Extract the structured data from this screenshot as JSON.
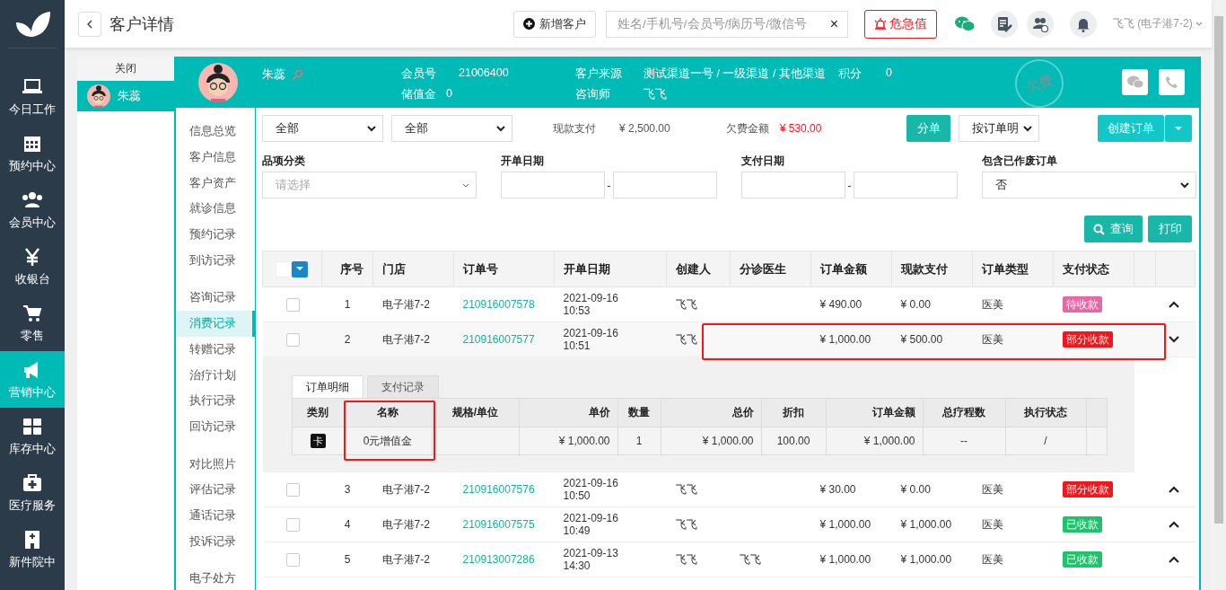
{
  "nav": {
    "items": [
      {
        "label": "今日工作",
        "selected": false
      },
      {
        "label": "预约中心",
        "selected": false
      },
      {
        "label": "会员中心",
        "selected": false
      },
      {
        "label": "收银台",
        "selected": false
      },
      {
        "label": "零售",
        "selected": false
      },
      {
        "label": "营销中心",
        "selected": true
      },
      {
        "label": "库存中心",
        "selected": false
      },
      {
        "label": "医疗服务",
        "selected": false
      },
      {
        "label": "新件院中",
        "selected": false
      }
    ]
  },
  "header": {
    "title": "客户详情",
    "add_button": "新增客户",
    "search": {
      "placeholder": "姓名/手机号/会员号/病历号/微信号",
      "clear": "×"
    },
    "alert_button": "危急值",
    "user": "飞飞 (电子港7-2)"
  },
  "open_tabs": {
    "close": "关闭",
    "items": [
      {
        "name": "朱蕊",
        "selected": true
      }
    ]
  },
  "customer": {
    "name": "朱蕊",
    "stamp": "欠费",
    "fields": [
      {
        "label": "会员号",
        "value": "21006400"
      },
      {
        "label": "储值金",
        "value": "0"
      },
      {
        "label": "客户来源",
        "value": "测试渠道一号 / 一级渠道 / 其他渠道"
      },
      {
        "label": "咨询师",
        "value": "飞飞"
      },
      {
        "label": "积分",
        "value": "0"
      }
    ]
  },
  "subnav": {
    "groups": [
      [
        {
          "label": "信息总览",
          "selected": false
        },
        {
          "label": "客户信息",
          "selected": false
        },
        {
          "label": "客户资产",
          "selected": false
        },
        {
          "label": "就诊信息",
          "selected": false
        },
        {
          "label": "预约记录",
          "selected": false
        },
        {
          "label": "到访记录",
          "selected": false
        }
      ],
      [
        {
          "label": "咨询记录",
          "selected": false
        },
        {
          "label": "消费记录",
          "selected": true
        },
        {
          "label": "转赠记录",
          "selected": false
        },
        {
          "label": "治疗计划",
          "selected": false
        },
        {
          "label": "执行记录",
          "selected": false
        },
        {
          "label": "回访记录",
          "selected": false
        }
      ],
      [
        {
          "label": "对比照片",
          "selected": false
        },
        {
          "label": "评估记录",
          "selected": false
        },
        {
          "label": "通话记录",
          "selected": false
        },
        {
          "label": "投诉记录",
          "selected": false
        }
      ],
      [
        {
          "label": "电子处方",
          "selected": false
        }
      ]
    ]
  },
  "filters": {
    "select_1": "全部",
    "select_2": "全部",
    "cash_label": "现款支付",
    "cash_value": "¥ 2,500.00",
    "arrears_label": "欠费金额",
    "arrears_value": "¥ 530.00",
    "split_button": "分单",
    "mode_select": "按订单明",
    "create_button": "创建订单",
    "category_label": "品项分类",
    "category_placeholder": "请选择",
    "open_date_label": "开单日期",
    "pay_date_label": "支付日期",
    "range_sep": "-",
    "void_label": "包含已作废订单",
    "void_value": "否",
    "query_button": "查询",
    "print_button": "打印"
  },
  "orders": {
    "select_all_checked": false,
    "columns": [
      "序号",
      "门店",
      "订单号",
      "开单日期",
      "创建人",
      "分诊医生",
      "订单金额",
      "现款支付",
      "订单类型",
      "支付状态"
    ],
    "rows": [
      {
        "checked": false,
        "expanded": false,
        "highlighted": false,
        "no": "1",
        "store": "电子港7-2",
        "order_no": "210916007578",
        "date": "2021-09-16 10:53",
        "creator": "飞飞",
        "amount": "¥ 490.00",
        "cash": "¥ 0.00",
        "type": "医美",
        "status": "待收款",
        "color": "#e868a6"
      },
      {
        "checked": false,
        "expanded": true,
        "highlighted": true,
        "no": "2",
        "store": "电子港7-2",
        "order_no": "210916007577",
        "date": "2021-09-16 10:51",
        "creator": "飞飞",
        "amount": "¥ 1,000.00",
        "cash": "¥ 500.00",
        "type": "医美",
        "status": "部分收款",
        "color": "#f5151b"
      },
      {
        "checked": false,
        "expanded": false,
        "highlighted": false,
        "no": "3",
        "store": "电子港7-2",
        "order_no": "210916007576",
        "date": "2021-09-16 10:50",
        "creator": "飞飞",
        "amount": "¥ 30.00",
        "cash": "¥ 0.00",
        "type": "医美",
        "status": "部分收款",
        "color": "#f5151b"
      },
      {
        "checked": false,
        "expanded": false,
        "highlighted": false,
        "no": "4",
        "store": "电子港7-2",
        "order_no": "210916007575",
        "date": "2021-09-16 10:49",
        "creator": "飞飞",
        "amount": "¥ 1,000.00",
        "cash": "¥ 1,000.00",
        "type": "医美",
        "status": "已收款",
        "color": "#1ec46c"
      },
      {
        "checked": false,
        "expanded": false,
        "highlighted": false,
        "no": "5",
        "store": "电子港7-2",
        "order_no": "210913007286",
        "date": "2021-09-13 14:30",
        "creator": "飞飞",
        "triage_doctor": "飞飞",
        "amount": "¥ 1,000.00",
        "cash": "¥ 1,000.00",
        "type": "医美",
        "status": "已收款",
        "color": "#1ec46c"
      }
    ],
    "detail": {
      "tabs": [
        {
          "label": "订单明细",
          "selected": true
        },
        {
          "label": "支付记录",
          "selected": false
        }
      ],
      "columns": [
        {
          "label": "类别",
          "highlighted": false,
          "value": "卡"
        },
        {
          "label": "名称",
          "highlighted": true,
          "value": "0元增值金"
        },
        {
          "label": "规格/单位",
          "highlighted": false
        },
        {
          "label": "单价",
          "highlighted": false,
          "value": "¥ 1,000.00"
        },
        {
          "label": "数量",
          "highlighted": false,
          "value": "1"
        },
        {
          "label": "总价",
          "highlighted": false,
          "value": "¥ 1,000.00"
        },
        {
          "label": "折扣",
          "highlighted": false,
          "value": "100.00"
        },
        {
          "label": "订单金额",
          "highlighted": false,
          "value": "¥ 1,000.00"
        },
        {
          "label": "总疗程数",
          "highlighted": false,
          "value": "--"
        },
        {
          "label": "执行状态",
          "highlighted": false,
          "value": "/"
        }
      ]
    }
  }
}
